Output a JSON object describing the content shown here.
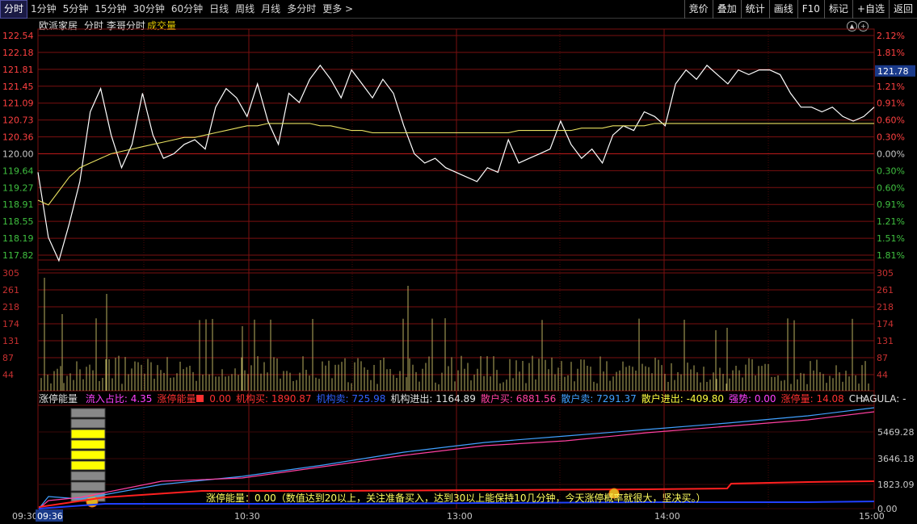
{
  "toolbar": {
    "tabs": [
      "分时",
      "1分钟",
      "5分钟",
      "15分钟",
      "30分钟",
      "60分钟",
      "日线",
      "周线",
      "月线",
      "多分时",
      "更多 >"
    ],
    "active_tab": "分时",
    "right_buttons": [
      "竞价",
      "叠加",
      "统计",
      "画线",
      "F10",
      "标记",
      "+自选",
      "返回"
    ]
  },
  "info": {
    "stock_name": "欧派家居",
    "view_name": "分时 李哥分时",
    "volume_label": "成交量"
  },
  "price_axis": {
    "left_ticks": [
      "122.54",
      "122.18",
      "121.81",
      "121.45",
      "121.09",
      "120.73",
      "120.36",
      "120.00",
      "119.64",
      "119.27",
      "118.91",
      "118.55",
      "118.19",
      "117.82"
    ],
    "right_ticks": [
      "2.12%",
      "1.81%",
      "1.51%",
      "1.21%",
      "0.91%",
      "0.60%",
      "0.30%",
      "0.00%",
      "0.30%",
      "0.60%",
      "0.91%",
      "1.21%",
      "1.51%",
      "1.81%"
    ],
    "current_price": "121.78"
  },
  "volume_axis": {
    "ticks": [
      "305",
      "261",
      "218",
      "174",
      "131",
      "87",
      "44"
    ]
  },
  "indicator": {
    "name": "涨停能量",
    "items": [
      {
        "label": "流入占比:",
        "value": "4.35",
        "label_color": "#ff40ff",
        "value_color": "#ff40ff"
      },
      {
        "label": "涨停能量",
        "value": "0.00",
        "label_color": "#ff3030",
        "value_color": "#ff3030",
        "swatch": true
      },
      {
        "label": "机构买:",
        "value": "1890.87",
        "label_color": "#ff3030",
        "value_color": "#ff3030"
      },
      {
        "label": "机构卖:",
        "value": "725.98",
        "label_color": "#3060ff",
        "value_color": "#3060ff"
      },
      {
        "label": "机构进出:",
        "value": "1164.89",
        "label_color": "#e0e0e0",
        "value_color": "#e0e0e0"
      },
      {
        "label": "散户买:",
        "value": "6881.56",
        "label_color": "#ff40a0",
        "value_color": "#ff40a0"
      },
      {
        "label": "散户卖:",
        "value": "7291.37",
        "label_color": "#40a0ff",
        "value_color": "#40a0ff"
      },
      {
        "label": "散户进出:",
        "value": "-409.80",
        "label_color": "#ffff40",
        "value_color": "#ffff40"
      },
      {
        "label": "强势:",
        "value": "0.00",
        "label_color": "#ff40ff",
        "value_color": "#ff40ff"
      },
      {
        "label": "涨停量:",
        "value": "14.08",
        "label_color": "#ff3030",
        "value_color": "#ff3030"
      },
      {
        "label": "CHAGULA:",
        "value": "-",
        "label_color": "#e0e0e0",
        "value_color": "#e0e0e0"
      }
    ],
    "ticks": [
      "5469.28",
      "3646.18",
      "1823.09",
      "0.00"
    ],
    "note": "涨停能量：0.00（数值达到20以上，关注准备买入，达到30以上能保持10几分钟，今天涨停概率就很大，坚决买。）"
  },
  "time_axis": {
    "labels": [
      "09:30",
      "10:30",
      "13:00",
      "14:00",
      "15:00"
    ],
    "cursor_time": "09:36"
  },
  "colors": {
    "grid": "#7a1010",
    "price_line": "#ffffff",
    "avg_line": "#e8e060",
    "volume": "#b8b060",
    "up_text": "#ff4040",
    "down_text": "#40c040"
  },
  "chart_data": {
    "type": "line",
    "x_range": [
      "09:30",
      "15:00"
    ],
    "ylim": [
      117.82,
      122.54
    ],
    "series": [
      {
        "values": [
          119.6,
          118.2,
          117.7,
          118.5,
          119.4,
          120.9,
          121.4,
          120.4,
          119.7,
          120.2,
          121.3,
          120.4,
          119.9,
          120.0,
          120.2,
          120.3,
          120.1,
          121.0,
          121.4,
          121.2,
          120.8,
          121.5,
          120.7,
          120.2,
          121.3,
          121.1,
          121.6,
          121.9,
          121.6,
          121.2,
          121.8,
          121.5,
          121.2,
          121.6,
          121.3,
          120.6,
          120.0,
          119.8,
          119.9,
          119.7,
          119.6,
          119.5,
          119.4,
          119.7,
          119.6,
          120.3,
          119.8,
          119.9,
          120.0,
          120.1,
          120.7,
          120.2,
          119.9,
          120.1,
          119.8,
          120.4,
          120.6,
          120.5,
          120.9,
          120.8,
          120.6,
          121.5,
          121.8,
          121.6,
          121.9,
          121.7,
          121.5,
          121.8,
          121.7,
          121.8,
          121.8,
          121.7,
          121.3,
          121.0,
          121.0,
          120.9,
          121.0,
          120.8,
          120.7,
          120.8,
          121.0
        ],
        "color_key": "price_line"
      },
      {
        "values": [
          119.0,
          118.9,
          119.2,
          119.5,
          119.7,
          119.8,
          119.9,
          120.0,
          120.05,
          120.1,
          120.15,
          120.2,
          120.25,
          120.3,
          120.35,
          120.35,
          120.4,
          120.45,
          120.5,
          120.55,
          120.6,
          120.6,
          120.65,
          120.65,
          120.65,
          120.65,
          120.65,
          120.6,
          120.6,
          120.55,
          120.5,
          120.5,
          120.45,
          120.45,
          120.45,
          120.45,
          120.45,
          120.45,
          120.45,
          120.45,
          120.45,
          120.45,
          120.45,
          120.45,
          120.45,
          120.45,
          120.5,
          120.5,
          120.5,
          120.5,
          120.5,
          120.5,
          120.55,
          120.55,
          120.55,
          120.6,
          120.6,
          120.6,
          120.6,
          120.65,
          120.65,
          120.65,
          120.65,
          120.65,
          120.65,
          120.65,
          120.65,
          120.65,
          120.65,
          120.65,
          120.65,
          120.65,
          120.65,
          120.65,
          120.65,
          120.65,
          120.65,
          120.65,
          120.65,
          120.65,
          120.65
        ],
        "color_key": "avg_line"
      }
    ]
  }
}
